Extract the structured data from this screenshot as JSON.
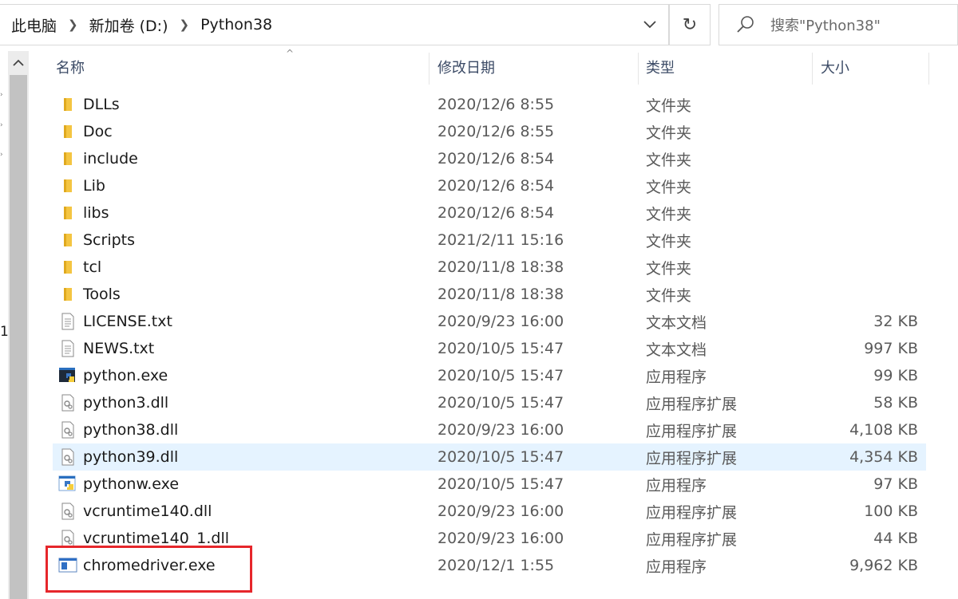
{
  "breadcrumb": {
    "items": [
      "此电脑",
      "新加卷 (D:)",
      "Python38"
    ]
  },
  "search": {
    "placeholder": "搜索\"Python38\""
  },
  "nav": {
    "partial_label": "1"
  },
  "columns": {
    "name": "名称",
    "date": "修改日期",
    "type": "类型",
    "size": "大小"
  },
  "files": [
    {
      "name": "DLLs",
      "date": "2020/12/6 8:55",
      "type": "文件夹",
      "size": "",
      "icon": "folder-icon"
    },
    {
      "name": "Doc",
      "date": "2020/12/6 8:55",
      "type": "文件夹",
      "size": "",
      "icon": "folder-icon"
    },
    {
      "name": "include",
      "date": "2020/12/6 8:54",
      "type": "文件夹",
      "size": "",
      "icon": "folder-icon"
    },
    {
      "name": "Lib",
      "date": "2020/12/6 8:54",
      "type": "文件夹",
      "size": "",
      "icon": "folder-icon"
    },
    {
      "name": "libs",
      "date": "2020/12/6 8:54",
      "type": "文件夹",
      "size": "",
      "icon": "folder-icon"
    },
    {
      "name": "Scripts",
      "date": "2021/2/11 15:16",
      "type": "文件夹",
      "size": "",
      "icon": "folder-icon"
    },
    {
      "name": "tcl",
      "date": "2020/11/8 18:38",
      "type": "文件夹",
      "size": "",
      "icon": "folder-icon"
    },
    {
      "name": "Tools",
      "date": "2020/11/8 18:38",
      "type": "文件夹",
      "size": "",
      "icon": "folder-icon"
    },
    {
      "name": "LICENSE.txt",
      "date": "2020/9/23 16:00",
      "type": "文本文档",
      "size": "32 KB",
      "icon": "text-file-icon"
    },
    {
      "name": "NEWS.txt",
      "date": "2020/10/5 15:47",
      "type": "文本文档",
      "size": "997 KB",
      "icon": "text-file-icon"
    },
    {
      "name": "python.exe",
      "date": "2020/10/5 15:47",
      "type": "应用程序",
      "size": "99 KB",
      "icon": "python-console-icon"
    },
    {
      "name": "python3.dll",
      "date": "2020/10/5 15:47",
      "type": "应用程序扩展",
      "size": "58 KB",
      "icon": "dll-file-icon"
    },
    {
      "name": "python38.dll",
      "date": "2020/9/23 16:00",
      "type": "应用程序扩展",
      "size": "4,108 KB",
      "icon": "dll-file-icon"
    },
    {
      "name": "python39.dll",
      "date": "2020/10/5 15:47",
      "type": "应用程序扩展",
      "size": "4,354 KB",
      "icon": "dll-file-icon",
      "selected": true
    },
    {
      "name": "pythonw.exe",
      "date": "2020/10/5 15:47",
      "type": "应用程序",
      "size": "97 KB",
      "icon": "python-window-icon"
    },
    {
      "name": "vcruntime140.dll",
      "date": "2020/9/23 16:00",
      "type": "应用程序扩展",
      "size": "100 KB",
      "icon": "dll-file-icon"
    },
    {
      "name": "vcruntime140_1.dll",
      "date": "2020/9/23 16:00",
      "type": "应用程序扩展",
      "size": "44 KB",
      "icon": "dll-file-icon"
    },
    {
      "name": "chromedriver.exe",
      "date": "2020/12/1 1:55",
      "type": "应用程序",
      "size": "9,962 KB",
      "icon": "exe-app-icon"
    }
  ],
  "colors": {
    "selection": "#e5f3ff",
    "highlight_box": "#e6262b",
    "header_text": "#3c4b66",
    "folder": "#f4c542"
  }
}
